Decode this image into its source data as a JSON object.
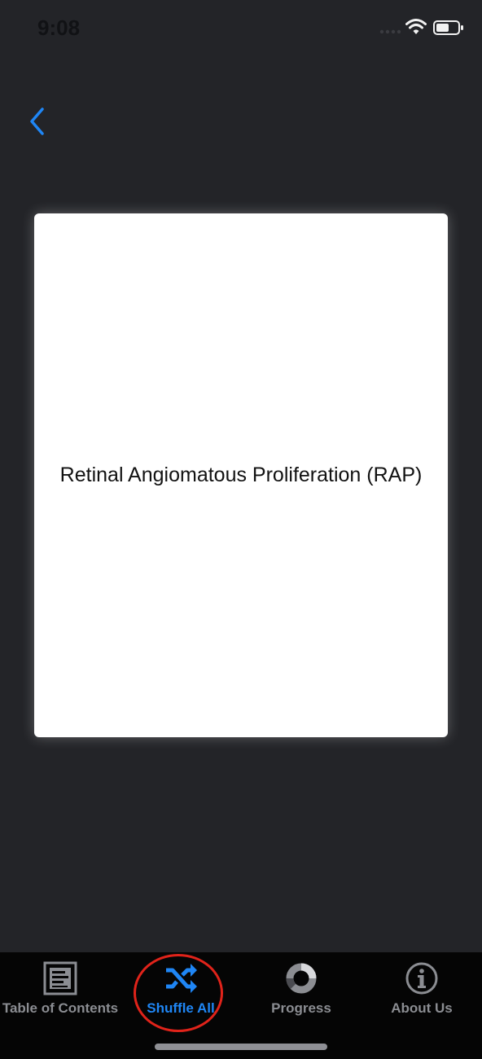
{
  "status_bar": {
    "time": "9:08"
  },
  "navigation": {
    "back_icon": "chevron-left-icon"
  },
  "card": {
    "text": "Retinal Angiomatous Proliferation (RAP)"
  },
  "tab_bar": {
    "tabs": [
      {
        "label": "Table of Contents",
        "icon": "list-document-icon",
        "active": false
      },
      {
        "label": "Shuffle All",
        "icon": "shuffle-icon",
        "active": true
      },
      {
        "label": "Progress",
        "icon": "progress-ring-icon",
        "active": false
      },
      {
        "label": "About Us",
        "icon": "info-icon",
        "active": false
      }
    ]
  },
  "colors": {
    "background": "#232428",
    "accent": "#1f86f5",
    "tab_bar_background": "#050505",
    "inactive_tab": "#8b8d92",
    "highlight_ring": "#e0231a"
  }
}
